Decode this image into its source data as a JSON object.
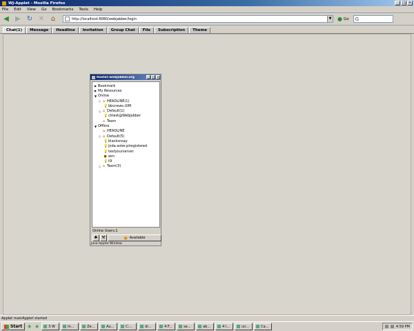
{
  "browser": {
    "title": "WJ-Applet - Mozilla Firefox",
    "menu": [
      "File",
      "Edit",
      "View",
      "Go",
      "Bookmarks",
      "Tools",
      "Help"
    ],
    "url": "http://localhost:8080/webjabber/login",
    "go_label": "Go"
  },
  "tabs": [
    "Chat(1)",
    "Message",
    "Headline",
    "Invitation",
    "Group Chat",
    "File",
    "Subscription",
    "Theme"
  ],
  "roster": {
    "title": "Roster-webJabber.org",
    "tree": [
      {
        "label": "Bookmark",
        "toggle": "▶",
        "icon": ""
      },
      {
        "label": "My Resources",
        "toggle": "▶",
        "icon": ""
      },
      {
        "label": "Online",
        "toggle": "▼",
        "icon": ""
      },
      {
        "label": "HEADLINE(1)",
        "toggle": "○",
        "icon": "⌂"
      },
      {
        "label": "bbcnews.UIM",
        "toggle": "",
        "icon": "💡"
      },
      {
        "label": "Default(1)",
        "toggle": "○",
        "icon": "⌂"
      },
      {
        "label": "clitest@WebJabber",
        "toggle": "",
        "icon": "💡"
      },
      {
        "label": "Team",
        "toggle": "",
        "icon": "⌂"
      },
      {
        "label": "Offline",
        "toggle": "▼",
        "icon": ""
      },
      {
        "label": "HEADLINE",
        "toggle": "",
        "icon": "⌂"
      },
      {
        "label": "Default(5)",
        "toggle": "○",
        "icon": "⌂"
      },
      {
        "label": "blacksnsay",
        "toggle": "",
        "icon": "💡"
      },
      {
        "label": "joda.aster.plregistered",
        "toggle": "",
        "icon": "💡"
      },
      {
        "label": "testyourserver",
        "toggle": "",
        "icon": "💡"
      },
      {
        "label": "wm",
        "toggle": "",
        "icon": "●"
      },
      {
        "label": "t9",
        "toggle": "",
        "icon": "💡"
      },
      {
        "label": "Team(3)",
        "toggle": "○",
        "icon": "⌂"
      }
    ],
    "online_users": "Online Users:1",
    "status_label": "Available",
    "java_label": "Java Applet Window"
  },
  "statusbar": {
    "text": "Applet mainApplet started"
  },
  "taskbar": {
    "start_label": "Start",
    "buttons": [
      "3 W",
      "In...",
      "Ze...",
      "Au...",
      "C:...",
      "di...",
      "4 F...",
      "se...",
      "ab...",
      "4 I...",
      "un...",
      "Ca..."
    ],
    "clock": "4:59 PM"
  }
}
